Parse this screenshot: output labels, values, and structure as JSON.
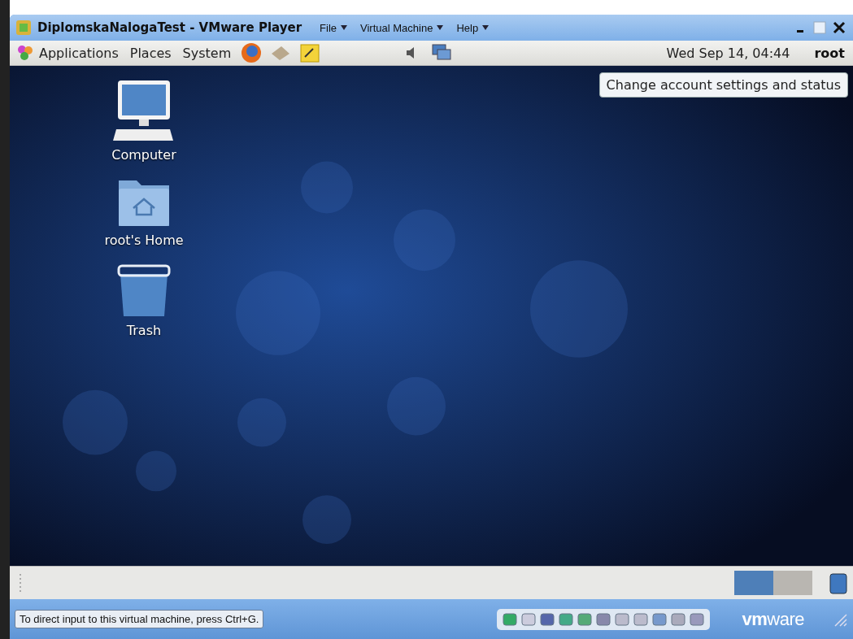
{
  "window": {
    "title": "DiplomskaNalogaTest - VMware Player",
    "menus": [
      {
        "label": "File"
      },
      {
        "label": "Virtual Machine"
      },
      {
        "label": "Help"
      }
    ]
  },
  "top_panel": {
    "menus": [
      "Applications",
      "Places",
      "System"
    ],
    "clock": "Wed Sep 14, 04:44",
    "user": "root"
  },
  "tooltip": "Change account settings and status",
  "desktop_icons": [
    {
      "kind": "computer",
      "label": "Computer"
    },
    {
      "kind": "home",
      "label": "root's Home"
    },
    {
      "kind": "trash",
      "label": "Trash"
    }
  ],
  "bottom_panel": {
    "workspaces": [
      {
        "selected": true
      },
      {
        "selected": false
      }
    ]
  },
  "status_bar": {
    "hint": "To direct input to this virtual machine, press Ctrl+G.",
    "brand": "**vm**ware"
  }
}
